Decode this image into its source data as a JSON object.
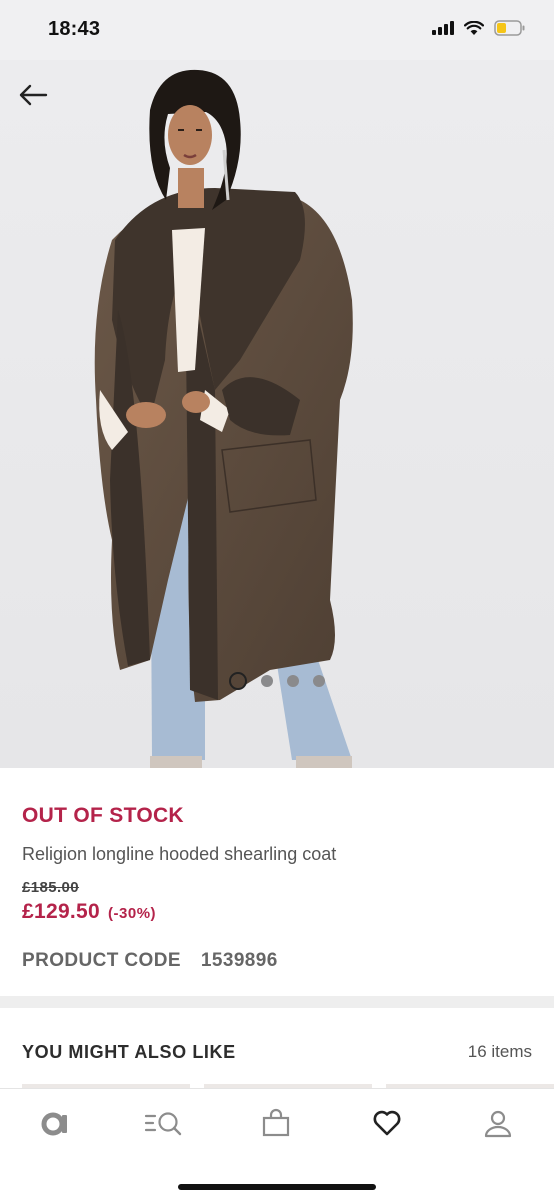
{
  "status_bar": {
    "time": "18:43",
    "signal_icon": "signal-bars-icon",
    "wifi_icon": "wifi-icon",
    "battery_icon": "battery-low-icon",
    "battery_color": "#f5c518"
  },
  "gallery": {
    "back_icon": "arrow-left-icon",
    "image": "model-wearing-brown-hooded-shearling-coat",
    "image_count": 4,
    "current_image": 1
  },
  "product": {
    "stock_status": "OUT OF STOCK",
    "name": "Religion longline hooded shearling coat",
    "old_price": "£185.00",
    "price": "£129.50",
    "discount": "(-30%)",
    "code_label": "PRODUCT CODE",
    "code_value": "1539896"
  },
  "recommendations": {
    "title": "YOU MIGHT ALSO LIKE",
    "count": "16 items"
  },
  "tab_bar": {
    "items": [
      {
        "icon": "asos-logo-icon"
      },
      {
        "icon": "search-menu-icon"
      },
      {
        "icon": "bag-icon"
      },
      {
        "icon": "heart-icon",
        "active": true
      },
      {
        "icon": "account-icon"
      }
    ]
  },
  "colors": {
    "accent": "#b4234a",
    "text": "#2d2d2d",
    "background": "#ffffff",
    "status_bar": "#f0f0f2"
  }
}
